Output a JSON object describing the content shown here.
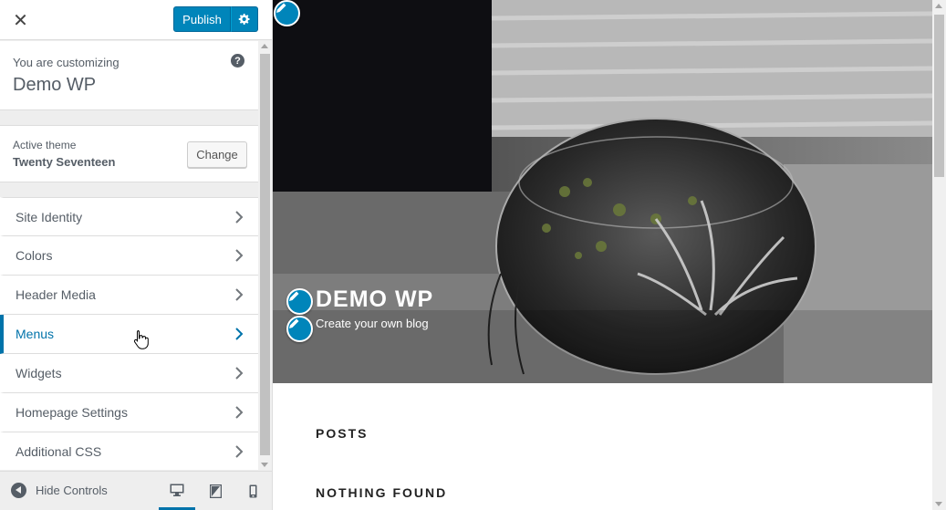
{
  "topbar": {
    "close_symbol": "✕",
    "publish_label": "Publish"
  },
  "info": {
    "label": "You are customizing",
    "title": "Demo WP",
    "help_symbol": "?"
  },
  "theme": {
    "label": "Active theme",
    "name": "Twenty Seventeen",
    "change_label": "Change"
  },
  "sections": [
    {
      "label": "Site Identity"
    },
    {
      "label": "Colors"
    },
    {
      "label": "Header Media"
    },
    {
      "label": "Menus"
    },
    {
      "label": "Widgets"
    },
    {
      "label": "Homepage Settings"
    },
    {
      "label": "Additional CSS"
    }
  ],
  "active_section": "Menus",
  "footer": {
    "hide_label": "Hide Controls",
    "devices": [
      "desktop-icon",
      "tablet-icon",
      "mobile-icon"
    ],
    "active_device": "desktop"
  },
  "preview": {
    "site_title": "DEMO WP",
    "site_description": "Create your own blog",
    "posts_heading": "POSTS",
    "nothing_found_heading": "NOTHING FOUND"
  },
  "colors": {
    "accent": "#0085ba",
    "active_section": "#0073aa"
  }
}
